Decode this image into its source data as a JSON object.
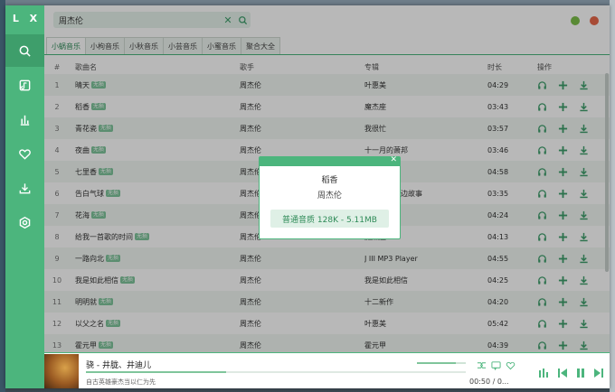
{
  "sidebar": {
    "logo": "L X",
    "items": [
      {
        "icon": "search-icon",
        "active": true
      },
      {
        "icon": "songlist-icon",
        "active": false
      },
      {
        "icon": "leaderboard-icon",
        "active": false
      },
      {
        "icon": "heart-icon",
        "active": false
      },
      {
        "icon": "download-icon",
        "active": false
      },
      {
        "icon": "settings-icon",
        "active": false
      }
    ]
  },
  "search": {
    "value": "周杰伦",
    "clear_icon": "close-icon",
    "search_icon": "search-icon"
  },
  "tabs": [
    "小蜗音乐",
    "小枸音乐",
    "小秋音乐",
    "小芸音乐",
    "小蜜音乐",
    "聚合大全"
  ],
  "table": {
    "headers": {
      "num": "#",
      "name": "歌曲名",
      "singer": "歌手",
      "album": "专辑",
      "time": "时长",
      "actions": "操作"
    },
    "badge": "无损",
    "rows": [
      {
        "num": "1",
        "name": "晴天",
        "singer": "周杰伦",
        "album": "叶惠美",
        "time": "04:29"
      },
      {
        "num": "2",
        "name": "稻香",
        "singer": "周杰伦",
        "album": "魔杰座",
        "time": "03:43"
      },
      {
        "num": "3",
        "name": "青花瓷",
        "singer": "周杰伦",
        "album": "我很忙",
        "time": "03:57"
      },
      {
        "num": "4",
        "name": "夜曲",
        "singer": "周杰伦",
        "album": "十一月的萧邦",
        "time": "03:46"
      },
      {
        "num": "5",
        "name": "七里香",
        "singer": "周杰伦",
        "album": "七里香",
        "time": "04:58"
      },
      {
        "num": "6",
        "name": "告白气球",
        "singer": "周杰伦",
        "album": "周杰伦的床边故事",
        "time": "03:35"
      },
      {
        "num": "7",
        "name": "花海",
        "singer": "周杰伦",
        "album": "魔杰座",
        "time": "04:24"
      },
      {
        "num": "8",
        "name": "给我一首歌的时间",
        "singer": "周杰伦",
        "album": "魔杰座",
        "time": "04:13"
      },
      {
        "num": "9",
        "name": "一路向北",
        "singer": "周杰伦",
        "album": "J III MP3 Player",
        "time": "04:55"
      },
      {
        "num": "10",
        "name": "我是如此相信",
        "singer": "周杰伦",
        "album": "我是如此相信",
        "time": "04:25"
      },
      {
        "num": "11",
        "name": "明明就",
        "singer": "周杰伦",
        "album": "十二新作",
        "time": "04:20"
      },
      {
        "num": "12",
        "name": "以父之名",
        "singer": "周杰伦",
        "album": "叶惠美",
        "time": "05:42"
      },
      {
        "num": "13",
        "name": "霍元甲",
        "singer": "周杰伦",
        "album": "霍元甲",
        "time": "04:39"
      }
    ]
  },
  "modal": {
    "title": "稻香",
    "singer": "周杰伦",
    "quality": "普通音质 128K - 5.11MB",
    "close_icon": "close-icon"
  },
  "player": {
    "title": "骁 - 井胧、井迪儿",
    "lyric": "自古英雄豪杰当以仁为先",
    "time": "00:50 / 0...",
    "progress": 0.37,
    "volume": 0.8
  },
  "colors": {
    "accent": "#4cb57d",
    "accent_dark": "#3e9e6b",
    "min_dot": "#7cc04a",
    "close_dot": "#e8684a"
  }
}
